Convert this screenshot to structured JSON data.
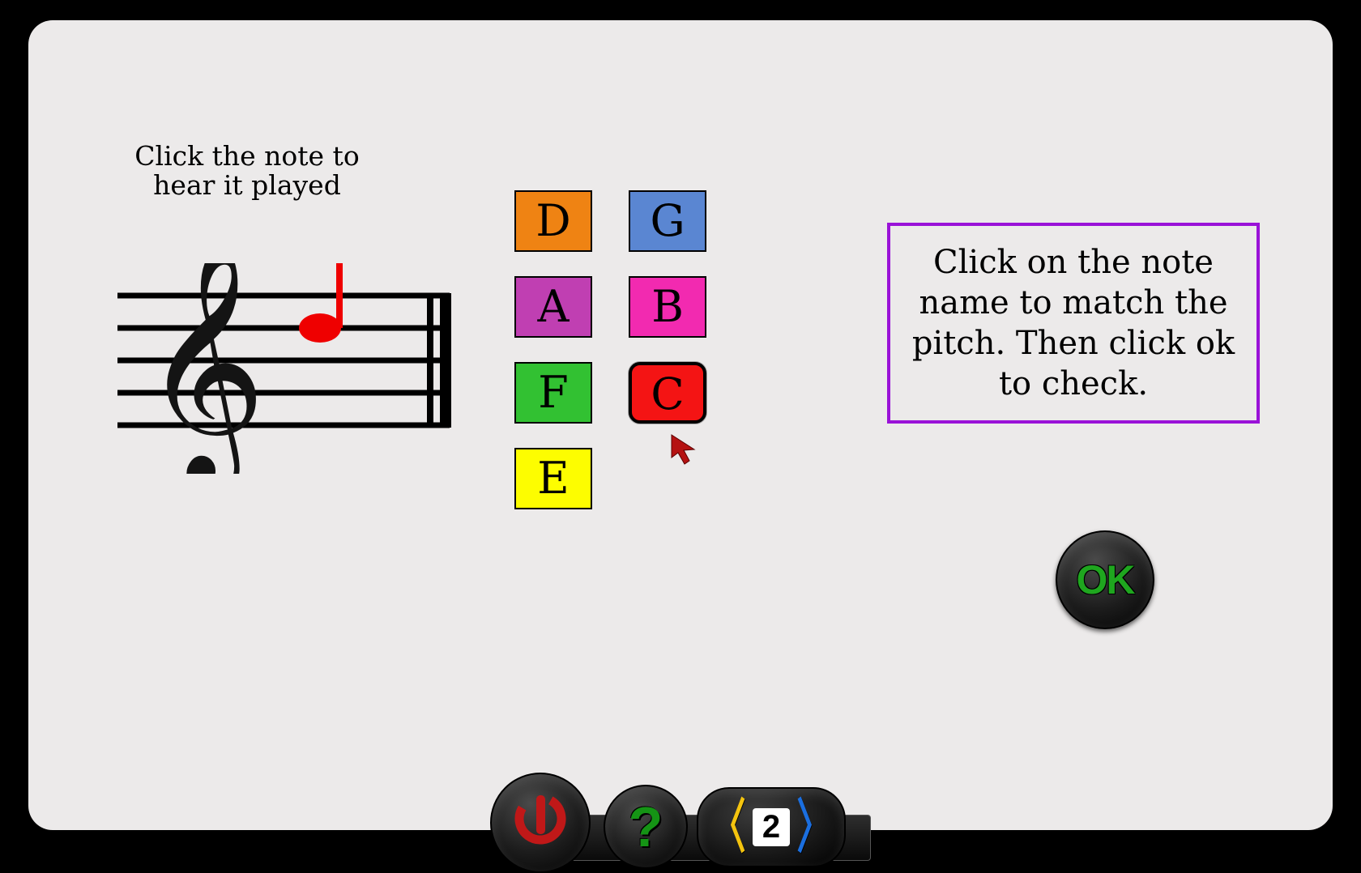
{
  "instructions": {
    "left": "Click the note to hear it played",
    "right": "Click on the note name to match the pitch. Then click ok to check."
  },
  "notes": {
    "column1": [
      {
        "label": "D",
        "color": "#ef8313"
      },
      {
        "label": "A",
        "color": "#c03fb2"
      },
      {
        "label": "F",
        "color": "#32c132"
      },
      {
        "label": "E",
        "color": "#fdfd00"
      }
    ],
    "column2": [
      {
        "label": "G",
        "color": "#5a86d2"
      },
      {
        "label": "B",
        "color": "#f22ab0"
      },
      {
        "label": "C",
        "color": "#f41414",
        "selected": true
      }
    ]
  },
  "ok_label": "OK",
  "toolbar": {
    "level": "2"
  },
  "staff": {
    "note_color": "#ef0000"
  }
}
